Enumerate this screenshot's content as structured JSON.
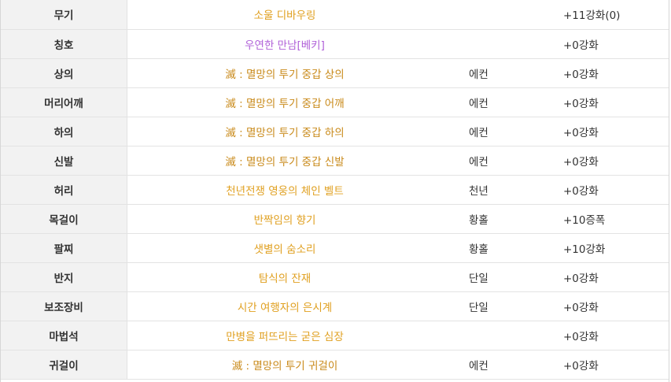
{
  "colors": {
    "rare": "#e0a020",
    "epic": "#c98a1a",
    "unique": "#b060d8",
    "amplify": "#a020c8",
    "normal": "#333333",
    "slot_bg": "#f2f2f2"
  },
  "equipment": [
    {
      "slot": "무기",
      "item": "소울 디바우링",
      "grade": "",
      "reinforce": "+11강화(0)",
      "item_color": "rare",
      "reinforce_color": "normal"
    },
    {
      "slot": "칭호",
      "item": "우연한 만남[베키]",
      "grade": "",
      "reinforce": "+0강화",
      "item_color": "unique",
      "reinforce_color": "normal"
    },
    {
      "slot": "상의",
      "item": "滅 : 멸망의 투기 중갑 상의",
      "grade": "에컨",
      "reinforce": "+0강화",
      "item_color": "epic",
      "reinforce_color": "normal"
    },
    {
      "slot": "머리어깨",
      "item": "滅 : 멸망의 투기 중갑 어깨",
      "grade": "에컨",
      "reinforce": "+0강화",
      "item_color": "epic",
      "reinforce_color": "normal"
    },
    {
      "slot": "하의",
      "item": "滅 : 멸망의 투기 중갑 하의",
      "grade": "에컨",
      "reinforce": "+0강화",
      "item_color": "epic",
      "reinforce_color": "normal"
    },
    {
      "slot": "신발",
      "item": "滅 : 멸망의 투기 중갑 신발",
      "grade": "에컨",
      "reinforce": "+0강화",
      "item_color": "epic",
      "reinforce_color": "normal"
    },
    {
      "slot": "허리",
      "item": "천년전쟁 영웅의 체인 벨트",
      "grade": "천년",
      "reinforce": "+0강화",
      "item_color": "rare",
      "reinforce_color": "normal"
    },
    {
      "slot": "목걸이",
      "item": "반짝임의 향기",
      "grade": "황홀",
      "reinforce": "+10증폭",
      "item_color": "rare",
      "reinforce_color": "amplify"
    },
    {
      "slot": "팔찌",
      "item": "샛별의 숨소리",
      "grade": "황홀",
      "reinforce": "+10강화",
      "item_color": "rare",
      "reinforce_color": "normal"
    },
    {
      "slot": "반지",
      "item": "탐식의 잔재",
      "grade": "단일",
      "reinforce": "+0강화",
      "item_color": "rare",
      "reinforce_color": "normal"
    },
    {
      "slot": "보조장비",
      "item": "시간 여행자의 은시계",
      "grade": "단일",
      "reinforce": "+0강화",
      "item_color": "rare",
      "reinforce_color": "normal"
    },
    {
      "slot": "마법석",
      "item": "만병을 퍼뜨리는 굳은 심장",
      "grade": "",
      "reinforce": "+0강화",
      "item_color": "rare",
      "reinforce_color": "normal"
    },
    {
      "slot": "귀걸이",
      "item": "滅 : 멸망의 투기 귀걸이",
      "grade": "에컨",
      "reinforce": "+0강화",
      "item_color": "epic",
      "reinforce_color": "normal"
    }
  ]
}
